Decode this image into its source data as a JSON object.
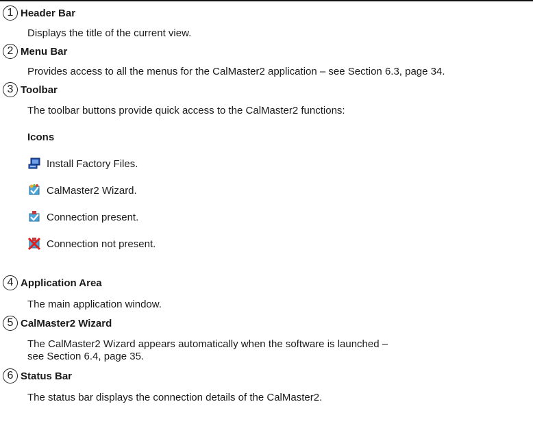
{
  "sections": [
    {
      "num": "1",
      "title": "Header Bar",
      "desc": "Displays the title of the current view."
    },
    {
      "num": "2",
      "title": "Menu Bar",
      "desc": "Provides access to all the menus for the CalMaster2 application – see Section 6.3, page 34."
    },
    {
      "num": "3",
      "title": "Toolbar",
      "desc": "The toolbar buttons provide quick access to the CalMaster2 functions:"
    },
    {
      "num": "4",
      "title": "Application Area",
      "desc": "The main application window."
    },
    {
      "num": "5",
      "title": "CalMaster2 Wizard",
      "desc_line1": "The CalMaster2 Wizard appears automatically when the software is launched –",
      "desc_line2": "see Section 6.4, page 35."
    },
    {
      "num": "6",
      "title": "Status Bar",
      "desc": "The status bar displays the connection details of the CalMaster2."
    }
  ],
  "icons_heading": "Icons",
  "icons": [
    {
      "icon": "install-factory-files-icon",
      "label": "Install Factory Files."
    },
    {
      "icon": "calmaster2-wizard-icon",
      "label": "CalMaster2 Wizard."
    },
    {
      "icon": "connection-present-icon",
      "label": "Connection present."
    },
    {
      "icon": "connection-not-present-icon",
      "label": "Connection not present."
    }
  ]
}
